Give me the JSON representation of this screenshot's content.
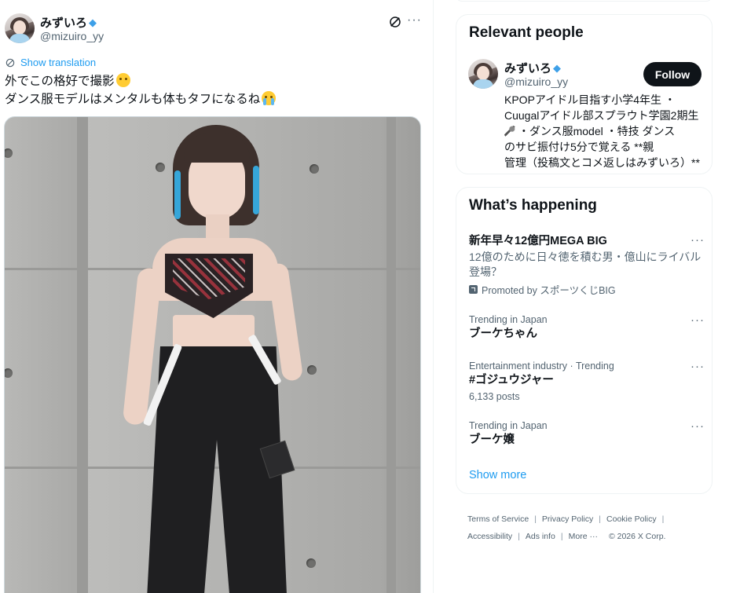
{
  "tweet": {
    "author": {
      "name": "みずいろ",
      "handle": "@mizuiro_yy",
      "verified_badge_icon": "gem-icon"
    },
    "show_translation": "Show translation",
    "text_lines": [
      "外でこの格好で撮影",
      "ダンス服モデルはメンタルも体もタフになるね"
    ],
    "line_emojis": [
      "smiling-face-with-tear-emoji",
      "crying-face-emoji"
    ]
  },
  "relevant_people": {
    "title": "Relevant people",
    "person": {
      "name": "みずいろ",
      "handle": "@mizuiro_yy",
      "follow_label": "Follow",
      "bio_lines": [
        "KPOPアイドル目指す小学4年生 ・",
        "Cuugalアイドル部スプラウト学園2期生",
        " ・ダンス服model ・特技 ダンス",
        "のサビ振付け5分で覚える  **親",
        "管理（投稿文とコメ返しはみずいろ）**"
      ]
    }
  },
  "whats_happening": {
    "title": "What’s happening",
    "trends": [
      {
        "title": "新年早々12億円MEGA BIG",
        "subtitle": "12億のために日々徳を積む男・億山にライバル登場？",
        "subtitle_lines": [
          "12億のために日々徳を積む男・億山にライバル",
          "登場？"
        ],
        "promoted": "Promoted by スポーツくじBIG"
      },
      {
        "meta": "Trending in Japan",
        "title": "ブーケちゃん"
      },
      {
        "meta": "Entertainment industry · Trending",
        "title": "#ゴジュウジャー",
        "posts": "6,133 posts"
      },
      {
        "meta": "Trending in Japan",
        "title": "ブーケ嬢"
      }
    ],
    "show_more": "Show more"
  },
  "footer": {
    "links": [
      "Terms of Service",
      "Privacy Policy",
      "Cookie Policy",
      "Accessibility",
      "Ads info",
      "More ···"
    ],
    "copyright": "© 2026 X Corp."
  },
  "colors": {
    "link": "#1d9bf0",
    "text": "#0f1419",
    "muted": "#536471",
    "follow_bg": "#0f1419",
    "border": "#eff3f4"
  }
}
